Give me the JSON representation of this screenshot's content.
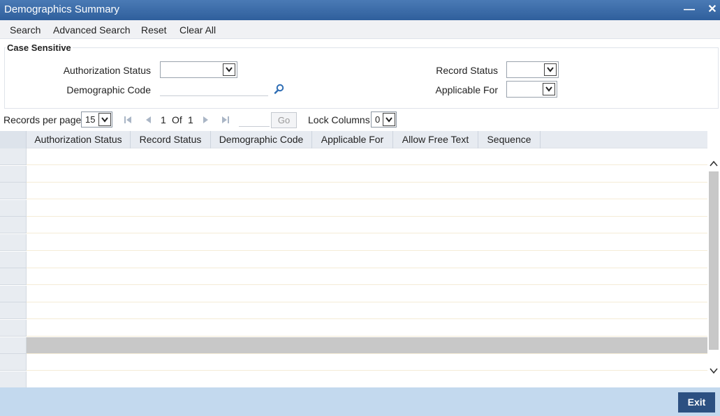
{
  "window": {
    "title": "Demographics Summary"
  },
  "menu": {
    "search": "Search",
    "advanced_search": "Advanced Search",
    "reset": "Reset",
    "clear_all": "Clear All"
  },
  "criteria": {
    "case_sensitive": "Case Sensitive",
    "authorization_status": {
      "label": "Authorization Status",
      "value": ""
    },
    "demographic_code": {
      "label": "Demographic Code",
      "value": ""
    },
    "record_status": {
      "label": "Record Status",
      "value": ""
    },
    "applicable_for": {
      "label": "Applicable For",
      "value": ""
    }
  },
  "pager": {
    "records_per_page_label": "Records per page",
    "records_per_page": "15",
    "current_page": "1",
    "of_label": "Of",
    "total_pages": "1",
    "go_label": "Go",
    "lock_columns_label": "Lock Columns",
    "lock_columns": "0"
  },
  "grid": {
    "columns": [
      "Authorization Status",
      "Record Status",
      "Demographic Code",
      "Applicable For",
      "Allow Free Text",
      "Sequence"
    ],
    "row_count": 14,
    "selected_row": 11
  },
  "footer": {
    "exit_label": "Exit"
  },
  "icons": {
    "minimize": "minimize-icon",
    "close": "close-icon",
    "lookup": "search-icon",
    "first": "first-page-icon",
    "prev": "previous-page-icon",
    "next": "next-page-icon",
    "last": "last-page-icon"
  }
}
